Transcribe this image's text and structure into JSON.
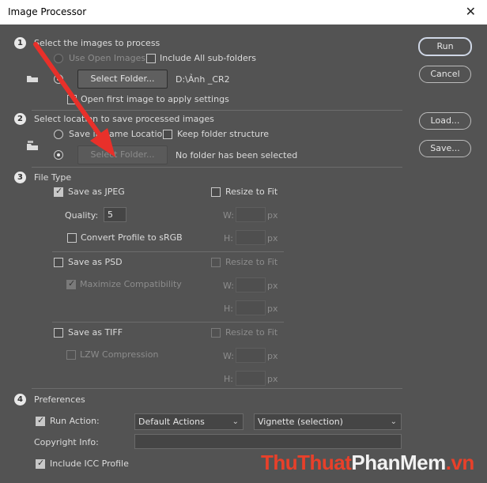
{
  "window": {
    "title": "Image Processor"
  },
  "section1": {
    "number": "1",
    "heading": "Select the images to process",
    "use_open_images": "Use Open Images",
    "include_subfolders": "Include All sub-folders",
    "select_folder": "Select Folder...",
    "folder_path": "D:\\Ảnh _CR2",
    "open_first_image": "Open first image to apply settings"
  },
  "section2": {
    "number": "2",
    "heading": "Select location to save processed images",
    "save_same_location": "Save in Same Location",
    "keep_folder_structure": "Keep folder structure",
    "select_folder": "Select Folder...",
    "folder_status": "No folder has been selected"
  },
  "section3": {
    "number": "3",
    "heading": "File Type",
    "jpeg": {
      "label": "Save as JPEG",
      "resize": "Resize to Fit",
      "quality_label": "Quality:",
      "quality_value": "5",
      "convert": "Convert Profile to sRGB",
      "w_label": "W:",
      "h_label": "H:",
      "unit": "px"
    },
    "psd": {
      "label": "Save as PSD",
      "resize": "Resize to Fit",
      "maximize": "Maximize Compatibility",
      "w_label": "W:",
      "h_label": "H:",
      "unit": "px"
    },
    "tiff": {
      "label": "Save as TIFF",
      "resize": "Resize to Fit",
      "lzw": "LZW Compression",
      "w_label": "W:",
      "h_label": "H:",
      "unit": "px"
    }
  },
  "section4": {
    "number": "4",
    "heading": "Preferences",
    "run_action": "Run Action:",
    "action_set": "Default Actions",
    "action": "Vignette (selection)",
    "copyright_label": "Copyright Info:",
    "include_icc": "Include ICC Profile"
  },
  "buttons": {
    "run": "Run",
    "cancel": "Cancel",
    "load": "Load...",
    "save": "Save..."
  },
  "watermark": {
    "part1": "ThuThuat",
    "part2": "PhanMem",
    "part3": ".vn"
  },
  "colors": {
    "background": "#535353",
    "arrow": "#e8302a",
    "watermark_red": "#e8402a"
  }
}
